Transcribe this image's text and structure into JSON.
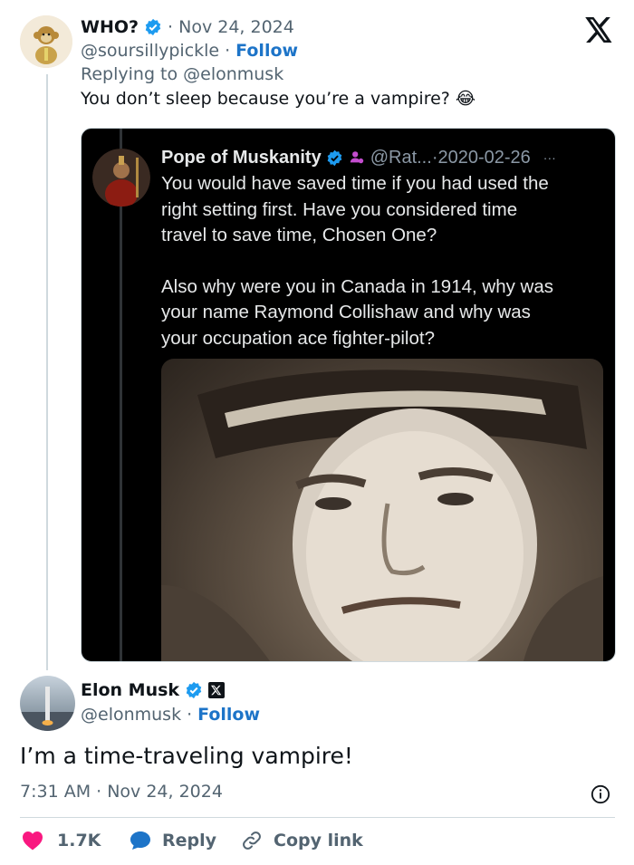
{
  "reply": {
    "name": "WHO?",
    "date": "· Nov 24, 2024",
    "handle": "@soursillypickle",
    "follow_sep": "·",
    "follow_label": "Follow",
    "replying_prefix": "Replying to",
    "replying_to": "@elonmusk",
    "text": "You don’t sleep because you’re a vampire? 😂"
  },
  "embed": {
    "name": "Pope of Muskanity",
    "handle": "@Rat...",
    "date": "·2020-02-26",
    "more": "···",
    "text_lines": [
      "You would have saved time if you had used the",
      "right setting first. Have you considered time",
      "travel to save time, Chosen One?",
      "Also why were you in Canada in 1914, why was",
      "your name Raymond Collishaw and why was",
      "your occupation ace fighter-pilot?"
    ]
  },
  "main": {
    "name": "Elon Musk",
    "handle": "@elonmusk",
    "follow_sep": "·",
    "follow_label": "Follow",
    "text": "I’m a time-traveling vampire!",
    "timestamp": "7:31 AM · Nov 24, 2024"
  },
  "actions": {
    "likes": "1.7K",
    "reply_label": "Reply",
    "copy_label": "Copy link"
  },
  "icons": {
    "brand": "x-logo-icon",
    "verified": "verified-badge-icon",
    "info": "info-icon",
    "like": "heart-icon",
    "reply": "reply-bubble-icon",
    "copy": "link-icon"
  },
  "colors": {
    "accent": "#1d9bf0",
    "link": "#1d74c8",
    "like": "#f91880",
    "muted": "#536471"
  }
}
